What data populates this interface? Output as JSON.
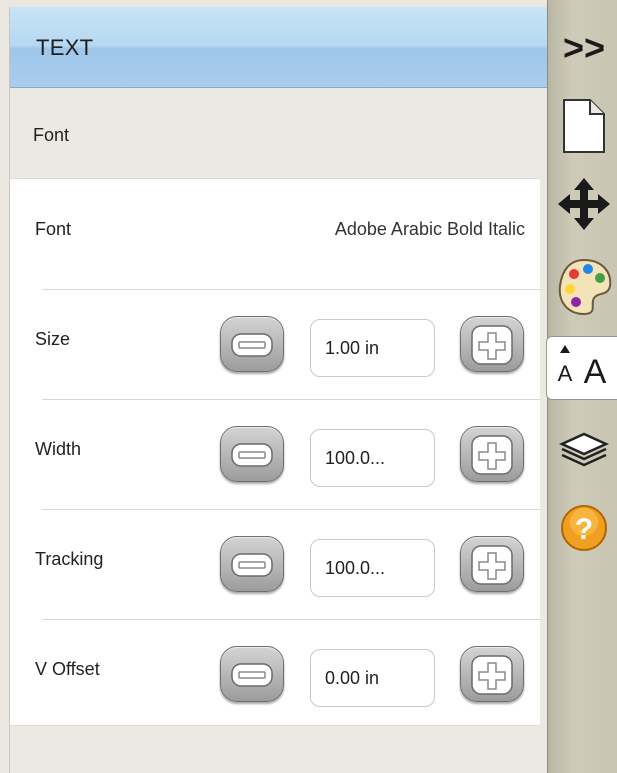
{
  "header": {
    "title": "TEXT"
  },
  "section": {
    "title": "Font"
  },
  "font_row": {
    "label": "Font",
    "value": "Adobe Arabic Bold Italic"
  },
  "rows": [
    {
      "label": "Size",
      "value": "1.00 in"
    },
    {
      "label": "Width",
      "value": "100.0..."
    },
    {
      "label": "Tracking",
      "value": "100.0..."
    },
    {
      "label": "V Offset",
      "value": "0.00 in"
    }
  ],
  "sidebar": {
    "collapse_glyph": ">>",
    "text_tool_glyph": "A",
    "help_glyph": "?",
    "items": [
      "collapse-icon",
      "page-icon",
      "move-icon",
      "palette-icon",
      "text-size-icon",
      "layers-icon",
      "help-icon"
    ],
    "active": "text-size-icon"
  },
  "colors": {
    "header": "#b6d8f1",
    "sidebar": "#c9c5b3",
    "help": "#f0a020"
  }
}
